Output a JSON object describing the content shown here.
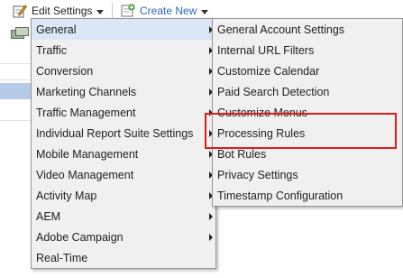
{
  "toolbar": {
    "edit_settings_label": "Edit Settings",
    "create_new_label": "Create New",
    "link_color": "#2a66b8"
  },
  "menu_main": {
    "items": [
      {
        "label": "General",
        "has_submenu": true,
        "highlighted": true
      },
      {
        "label": "Traffic",
        "has_submenu": true
      },
      {
        "label": "Conversion",
        "has_submenu": true
      },
      {
        "label": "Marketing Channels",
        "has_submenu": true
      },
      {
        "label": "Traffic Management",
        "has_submenu": true
      },
      {
        "label": "Individual Report Suite Settings",
        "has_submenu": true
      },
      {
        "label": "Mobile Management",
        "has_submenu": true
      },
      {
        "label": "Video Management",
        "has_submenu": true
      },
      {
        "label": "Activity Map",
        "has_submenu": true
      },
      {
        "label": "AEM",
        "has_submenu": true
      },
      {
        "label": "Adobe Campaign",
        "has_submenu": true
      },
      {
        "label": "Real-Time",
        "has_submenu": false
      }
    ]
  },
  "menu_sub": {
    "items": [
      {
        "label": "General Account Settings"
      },
      {
        "label": "Internal URL Filters"
      },
      {
        "label": "Customize Calendar"
      },
      {
        "label": "Paid Search Detection"
      },
      {
        "label": "Customize Menus"
      },
      {
        "label": "Processing Rules",
        "annotated": true
      },
      {
        "label": "Bot Rules"
      },
      {
        "label": "Privacy Settings"
      },
      {
        "label": "Timestamp Configuration"
      }
    ]
  },
  "annotation": {
    "color": "#e01b1b",
    "target": "Processing Rules"
  },
  "colors": {
    "menu_bg": "#f0f0f0",
    "highlight": "#dbe7f6",
    "selected_row": "#b7cbe8"
  }
}
